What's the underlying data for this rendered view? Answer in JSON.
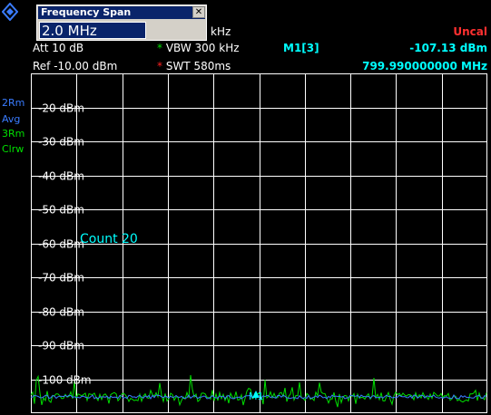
{
  "dialog": {
    "title": "Frequency Span",
    "close": "✕",
    "value": "2.0 MHz"
  },
  "header": {
    "span_unit": "kHz",
    "att": "Att  10 dB",
    "ref": "Ref  -10.00 dBm",
    "vbw": "VBW 300 kHz",
    "swt": "SWT 580ms",
    "status": "Uncal",
    "marker_name": "M1[3]",
    "marker_level": "-107.13 dBm",
    "marker_freq": "799.990000000 MHz"
  },
  "sidebar": {
    "trace2": "2Rm",
    "trace2_mode": "Avg",
    "trace3": "3Rm",
    "trace3_mode": "Clrw"
  },
  "plot": {
    "count_label": "Count 20",
    "marker_label": "M1",
    "y_labels": [
      "-20 dBm",
      "-30 dBm",
      "-40 dBm",
      "-50 dBm",
      "-60 dBm",
      "-70 dBm",
      "-80 dBm",
      "-90 dBm",
      "-100 dBm"
    ],
    "colors": {
      "green_trace": "#00e000",
      "blue_trace": "#3a7cff",
      "grid": "#ffffff"
    }
  }
}
